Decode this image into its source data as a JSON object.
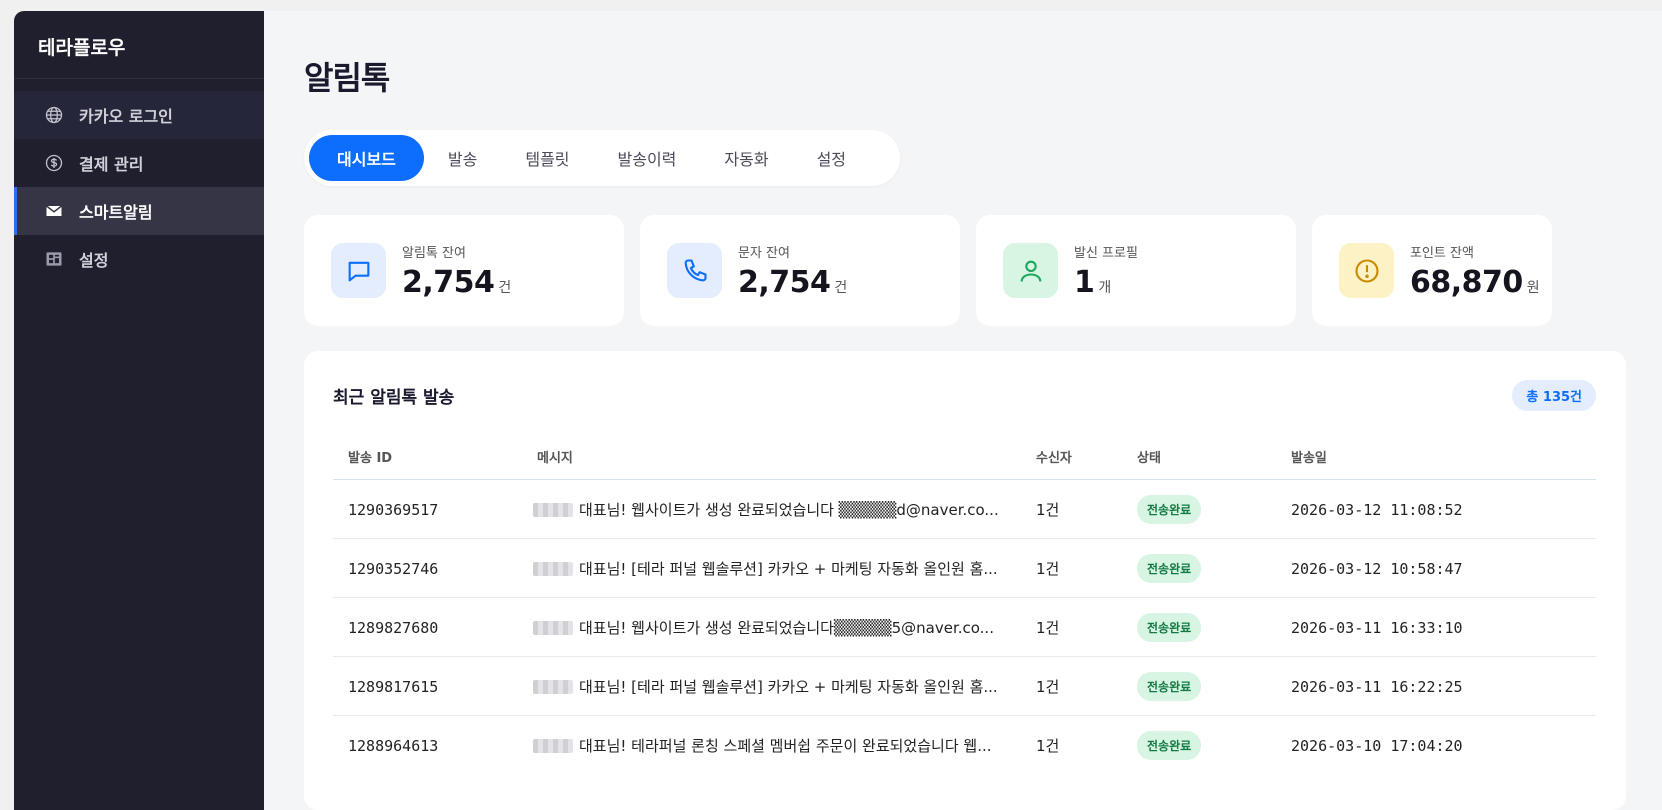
{
  "brand": "테라플로우",
  "sidebar": {
    "items": [
      {
        "label": "카카오 로그인",
        "icon": "globe-icon"
      },
      {
        "label": "결제 관리",
        "icon": "dollar-icon"
      },
      {
        "label": "스마트알림",
        "icon": "mail-icon"
      },
      {
        "label": "설정",
        "icon": "dashboard-icon"
      }
    ]
  },
  "page_title": "알림톡",
  "tabs": [
    "대시보드",
    "발송",
    "템플릿",
    "발송이력",
    "자동화",
    "설정"
  ],
  "stats": [
    {
      "label": "알림톡 잔여",
      "value": "2,754",
      "unit": "건",
      "icon": "chat-icon",
      "color": "#0d6efd"
    },
    {
      "label": "문자 잔여",
      "value": "2,754",
      "unit": "건",
      "icon": "phone-icon",
      "color": "#0d6efd"
    },
    {
      "label": "발신 프로필",
      "value": "1",
      "unit": "개",
      "icon": "user-icon",
      "color": "#1aa85a"
    },
    {
      "label": "포인트 잔액",
      "value": "68,870",
      "unit": "원",
      "icon": "alert-icon",
      "color": "#c98a00"
    }
  ],
  "recent": {
    "title": "최근 알림톡 발송",
    "total": "총 135건",
    "columns": [
      "발송 ID",
      "메시지",
      "수신자",
      "상태",
      "발송일"
    ],
    "rows": [
      {
        "id": "1290369517",
        "message": "대표님! 웹사이트가 생성 완료되었습니다 ▒▒▒▒▒d@naver.co...",
        "recipients": "1건",
        "status": "전송완료",
        "date": "2026-03-12 11:08:52"
      },
      {
        "id": "1290352746",
        "message": "대표님! [테라 퍼널 웹솔루션] 카카오 + 마케팅 자동화 올인원 홈...",
        "recipients": "1건",
        "status": "전송완료",
        "date": "2026-03-12 10:58:47"
      },
      {
        "id": "1289827680",
        "message": "대표님! 웹사이트가 생성 완료되었습니다▒▒▒▒▒5@naver.co...",
        "recipients": "1건",
        "status": "전송완료",
        "date": "2026-03-11 16:33:10"
      },
      {
        "id": "1289817615",
        "message": "대표님! [테라 퍼널 웹솔루션] 카카오 + 마케팅 자동화 올인원 홈...",
        "recipients": "1건",
        "status": "전송완료",
        "date": "2026-03-11 16:22:25"
      },
      {
        "id": "1288964613",
        "message": "대표님! 테라퍼널 론칭 스페셜 멤버쉽 주문이 완료되었습니다 웹...",
        "recipients": "1건",
        "status": "전송완료",
        "date": "2026-03-10 17:04:20"
      }
    ]
  }
}
